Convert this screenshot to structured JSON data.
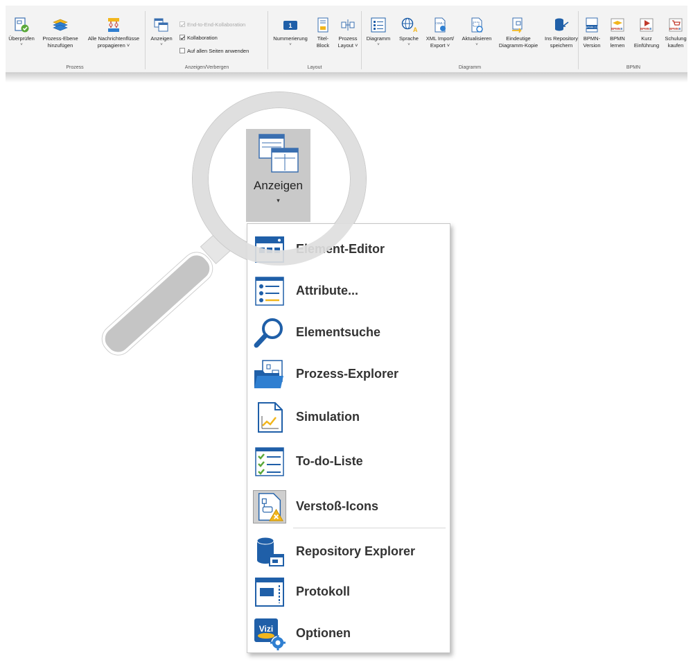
{
  "ribbon": {
    "groups": {
      "prozess": "Prozess",
      "anzeigen_verbergen": "Anzeigen/Verbergen",
      "layout": "Layout",
      "diagramm": "Diagramm",
      "bpmn": "BPMN"
    },
    "buttons": {
      "ueberpruefen": "Überprüfen",
      "prozess_ebene_1": "Prozess-Ebene",
      "prozess_ebene_2": "hinzufügen",
      "nachrichtenfluesse_1": "Alle Nachrichtenflüsse",
      "nachrichtenfluesse_2": "propagieren",
      "anzeigen": "Anzeigen",
      "nummerierung": "Nummerierung",
      "titel_block_1": "Titel-",
      "titel_block_2": "Block",
      "prozess_layout_1": "Prozess",
      "prozess_layout_2": "Layout",
      "diagramm": "Diagramm",
      "sprache": "Sprache",
      "xml_1": "XML Import/",
      "xml_2": "Export",
      "aktualisieren": "Aktualisieren",
      "eindeutige_1": "Eindeutige",
      "eindeutige_2": "Diagramm-Kopie",
      "repository_1": "Ins Repository",
      "repository_2": "speichern",
      "bpmn_version_1": "BPMN-",
      "bpmn_version_2": "Version",
      "bpmn_lernen_1": "BPMN",
      "bpmn_lernen_2": "lernen",
      "kurz_1": "Kurz",
      "kurz_2": "Einführung",
      "schulung_1": "Schulung",
      "schulung_2": "kaufen"
    },
    "dropdown_marker": "˅",
    "checkboxes": {
      "end_to_end": "End-to-End-Kollaboration",
      "kollaboration": "Kollaboration",
      "auf_allen_seiten": "Auf allen Seiten anwenden"
    },
    "icon_badges": {
      "nummerierung": "1",
      "bpmn_version": "BPMN 2.0",
      "bpmne": "BPMN",
      "e": "E",
      "xml": "<XML>"
    }
  },
  "zoom": {
    "label": "Anzeigen",
    "caret": "▾"
  },
  "menu": {
    "items": [
      {
        "label": "Element-Editor",
        "icon": "element-editor-icon"
      },
      {
        "label": "Attribute...",
        "icon": "attribute-list-icon"
      },
      {
        "label": "Elementsuche",
        "icon": "magnifier-icon"
      },
      {
        "label": "Prozess-Explorer",
        "icon": "process-explorer-folder-icon"
      },
      {
        "label": "Simulation",
        "icon": "simulation-chart-icon"
      },
      {
        "label": "To-do-Liste",
        "icon": "todo-list-icon"
      },
      {
        "label": "Verstoß-Icons",
        "icon": "violation-warning-icon"
      },
      {
        "label": "Repository Explorer",
        "icon": "repository-database-icon"
      },
      {
        "label": "Protokoll",
        "icon": "protocol-window-icon"
      },
      {
        "label": "Optionen",
        "icon": "vizi-options-icon"
      }
    ],
    "vizi_logo_text": "Vizi",
    "selected_index": 6
  },
  "colors": {
    "accent_blue": "#1f5fa8",
    "warning_yellow": "#f2b61c",
    "check_green": "#5aa83a",
    "ribbon_bg": "#f3f3f3"
  }
}
